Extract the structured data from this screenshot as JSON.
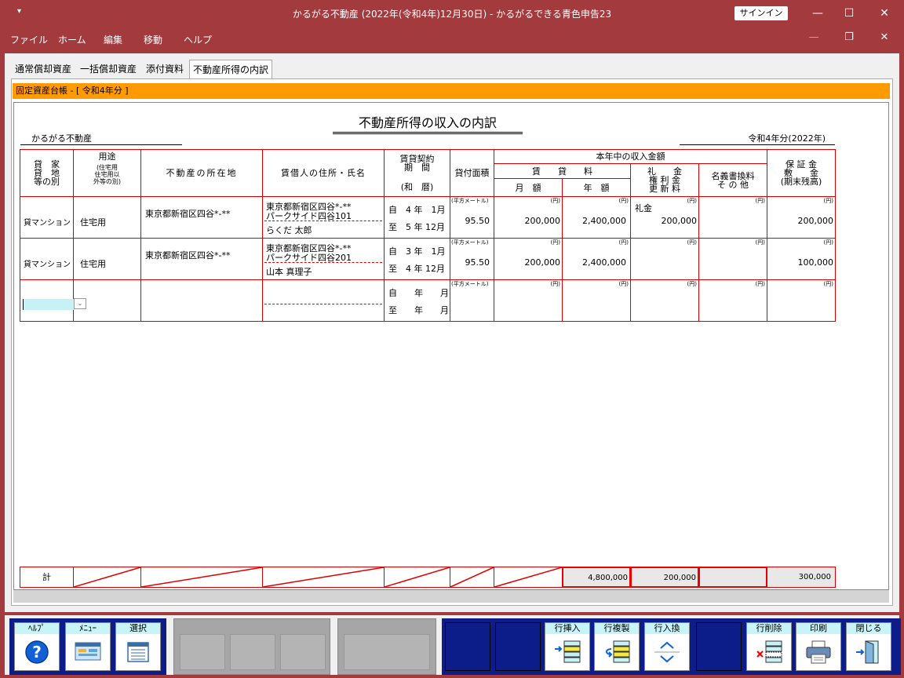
{
  "window": {
    "sysmenu": "▾",
    "title": "かるがる不動産 (2022年(令和4年)12月30日)  -  かるがるできる青色申告23",
    "signin": "サインイン",
    "minimize": "—",
    "maximize": "☐",
    "close": "✕"
  },
  "menubar": {
    "items": [
      "ファイル",
      "ホーム",
      "編集",
      "移動",
      "ヘルプ"
    ],
    "restore": "❐",
    "close": "✕"
  },
  "tabs": [
    "通常償却資産",
    "一括償却資産",
    "添付資料",
    "不動産所得の内訳"
  ],
  "orange_bar": "固定資産台帳 - [ 令和4年分 ]",
  "doc": {
    "title": "不動産所得の収入の内訳",
    "owner": "かるがる不動産",
    "year": "令和4年分(2022年)"
  },
  "headers": {
    "type": "貸　家\n貸　地\n等の別",
    "usage_title": "用途",
    "usage_sub": "(住宅用\n住宅用以\n外等の別)",
    "location": "不動産の所在地",
    "tenant": "賃借人の住所・氏名",
    "period": "賃貸契約\n期　間",
    "period_sub": "(和　暦)",
    "area": "貸付面積",
    "income_group": "本年中の収入金額",
    "rent": "賃　　貸　　料",
    "monthly": "月　額",
    "annual": "年　額",
    "key_money": "礼　　金\n権 利 金\n更 新 料",
    "other": "名義書換料\nそ の 他",
    "deposit": "保 証 金\n敷　　金\n(期末残高)"
  },
  "units": {
    "sqm": "(平方メートル)",
    "yen": "(円)"
  },
  "rows": [
    {
      "type": "貸マンション",
      "usage": "住宅用",
      "location": "東京都新宿区四谷*-**",
      "tenant_address": "東京都新宿区四谷*-**",
      "tenant_building": "パークサイド四谷101",
      "tenant_name": "らくだ 太郎",
      "from": "自　4 年　1月",
      "to": "至　5 年 12月",
      "area": "95.50",
      "monthly": "200,000",
      "annual": "2,400,000",
      "key_label": "礼金",
      "key_money": "200,000",
      "other": "",
      "deposit": "200,000"
    },
    {
      "type": "貸マンション",
      "usage": "住宅用",
      "location": "東京都新宿区四谷*-**",
      "tenant_address": "東京都新宿区四谷*-**",
      "tenant_building": "パークサイド四谷201",
      "tenant_name": "山本 真理子",
      "from": "自　3 年　1月",
      "to": "至　4 年 12月",
      "area": "95.50",
      "monthly": "200,000",
      "annual": "2,400,000",
      "key_label": "",
      "key_money": "",
      "other": "",
      "deposit": "100,000"
    },
    {
      "type": "",
      "usage": "",
      "location": "",
      "tenant_address": "",
      "tenant_building": "",
      "tenant_name": "",
      "from": "自　　年　　月",
      "to": "至　　年　　月",
      "area": "",
      "monthly": "",
      "annual": "",
      "key_label": "",
      "key_money": "",
      "other": "",
      "deposit": ""
    }
  ],
  "totals": {
    "label": "計",
    "annual": "4,800,000",
    "key_money": "200,000",
    "other": "",
    "deposit": "300,000"
  },
  "toolbar": {
    "help": "ﾍﾙﾌﾟ",
    "menu": "ﾒﾆｭｰ",
    "select": "選択",
    "insert_row": "行挿入",
    "copy_row": "行複製",
    "swap_row": "行入換",
    "delete_row": "行削除",
    "print": "印刷",
    "close": "閉じる"
  },
  "colors": {
    "titlebar": "#a23a3e",
    "orange": "#ff9b00",
    "grid_red": "#dd0000",
    "toolbar_navy": "#0c1d8a",
    "button_label": "#c8f3f7"
  }
}
